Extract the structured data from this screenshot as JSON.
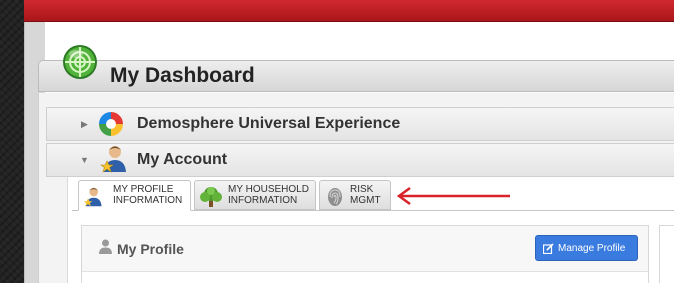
{
  "dashboard": {
    "title": "My Dashboard",
    "globe_icon": "globe-target-icon",
    "colors": {
      "top_bar": "#c0201f",
      "button_blue": "#3a7be0",
      "annotation_arrow": "#d9232a"
    }
  },
  "accordion": [
    {
      "label": "Demosphere Universal Experience",
      "icon": "demosphere-logo-icon",
      "state": "collapsed"
    },
    {
      "label": "My Account",
      "icon": "user-star-icon",
      "state": "expanded"
    }
  ],
  "tabs": [
    {
      "line1": "MY PROFILE",
      "line2": "INFORMATION",
      "icon": "user-star-icon",
      "active": true
    },
    {
      "line1": "MY HOUSEHOLD",
      "line2": "INFORMATION",
      "icon": "tree-icon",
      "active": false
    },
    {
      "line1": "RISK",
      "line2": "MGMT",
      "icon": "fingerprint-icon",
      "active": false
    }
  ],
  "profile_card": {
    "title": "My Profile",
    "icon": "person-icon",
    "manage_button_label": "Manage Profile",
    "manage_button_icon": "edit-icon"
  },
  "annotation": {
    "icon": "red-arrow-icon",
    "points_to": "RISK MGMT tab"
  }
}
